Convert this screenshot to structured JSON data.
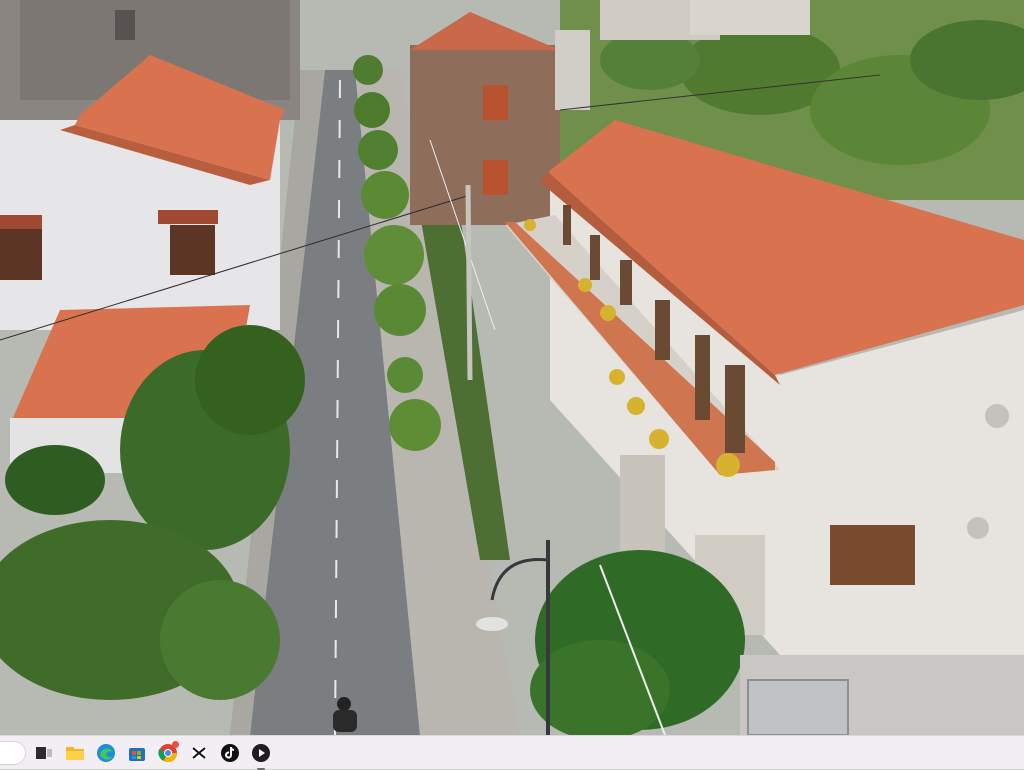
{
  "screen": {
    "description_visible_text": ""
  },
  "taskbar": {
    "items": [
      {
        "id": "search",
        "icon": "search-pill-icon"
      },
      {
        "id": "task-view",
        "icon": "task-view-icon"
      },
      {
        "id": "file-explorer",
        "icon": "folder-icon"
      },
      {
        "id": "edge",
        "icon": "edge-browser-icon"
      },
      {
        "id": "store",
        "icon": "store-icon"
      },
      {
        "id": "chrome",
        "icon": "chrome-icon",
        "badge": true
      },
      {
        "id": "capcut",
        "icon": "capcut-icon"
      },
      {
        "id": "tiktok",
        "icon": "tiktok-icon"
      },
      {
        "id": "media-player",
        "icon": "media-player-icon",
        "active": true
      }
    ]
  },
  "colors": {
    "roof": "#d9734f",
    "wall_light": "#e8e6e3",
    "road": "#7a7d7f",
    "sidewalk": "#b5b3ae",
    "tree": "#3f6b2a",
    "taskbar_bg": "#f3eef4"
  }
}
